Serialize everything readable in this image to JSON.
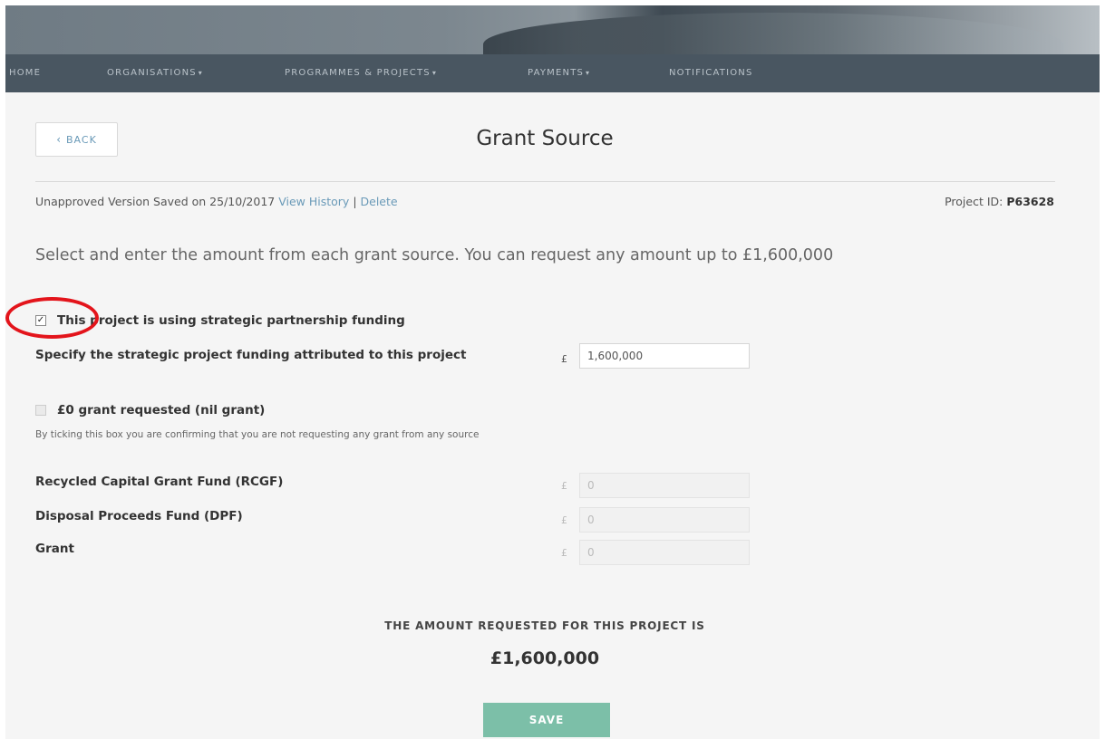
{
  "nav": {
    "items": [
      {
        "label": "HOME",
        "caret": ""
      },
      {
        "label": "ORGANISATIONS",
        "caret": "▾"
      },
      {
        "label": "PROGRAMMES & PROJECTS",
        "caret": "▾"
      },
      {
        "label": "PAYMENTS",
        "caret": "▾"
      },
      {
        "label": "NOTIFICATIONS",
        "caret": ""
      }
    ]
  },
  "header": {
    "back_label": "BACK",
    "title": "Grant Source"
  },
  "version": {
    "saved_text": "Unapproved Version Saved on 25/10/2017",
    "view_history": "View History",
    "separator": "|",
    "delete": "Delete",
    "project_id_label": "Project ID:",
    "project_id": "P63628"
  },
  "intro": "Select and enter the amount from each grant source. You can request any amount up to £1,600,000",
  "strategic": {
    "checked": true,
    "check_glyph": "✓",
    "label": "This project is using strategic partnership funding",
    "amount_label": "Specify the strategic project funding attributed to this project",
    "currency": "£",
    "amount_value": "1,600,000"
  },
  "nil_grant": {
    "checked": false,
    "label": "£0 grant requested (nil grant)",
    "helper": "By ticking this box you are confirming that you are not requesting any grant from any source"
  },
  "sources": [
    {
      "label": "Recycled Capital Grant Fund (RCGF)",
      "currency": "£",
      "value": "0"
    },
    {
      "label": "Disposal Proceeds Fund (DPF)",
      "currency": "£",
      "value": "0"
    },
    {
      "label": "Grant",
      "currency": "£",
      "value": "0"
    }
  ],
  "summary": {
    "label": "THE AMOUNT REQUESTED FOR THIS PROJECT IS",
    "amount": "£1,600,000"
  },
  "save_label": "SAVE",
  "colors": {
    "nav_bg": "#495661",
    "link": "#6a9ab8",
    "save_bg": "#7cbfa8",
    "annotation_red": "#e3141b"
  }
}
